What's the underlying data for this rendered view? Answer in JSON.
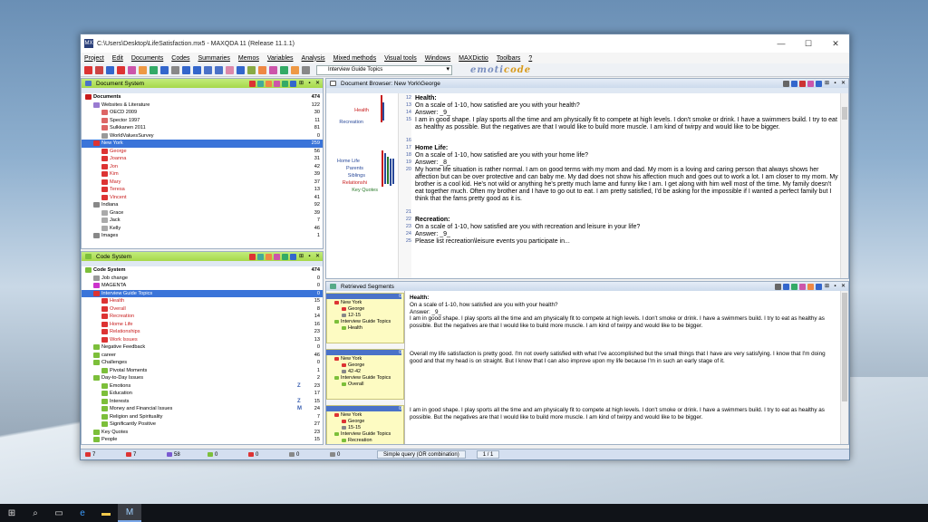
{
  "window": {
    "title": "C:\\Users\\Desktop\\LifeSatisfaction.mx5 - MAXQDA 11  (Release 11.1.1)",
    "app_icon": "MX"
  },
  "menu": [
    "Project",
    "Edit",
    "Documents",
    "Codes",
    "Summaries",
    "Memos",
    "Variables",
    "Analysis",
    "Mixed methods",
    "Visual tools",
    "Windows",
    "MAXDictio",
    "Toolbars",
    "?"
  ],
  "toolbar": {
    "combo_value": "Interview Guide Topics",
    "logo": "emoticode",
    "logo_left": "emoti",
    "logo_right": "code"
  },
  "doc_system": {
    "title": "Document System",
    "rows": [
      {
        "label": "Documents",
        "num": "474",
        "level": 0,
        "style": "bold",
        "color": "#c81c1c"
      },
      {
        "label": "Websites & Literature",
        "num": "122",
        "level": 1,
        "color": "#9a7bd1"
      },
      {
        "label": "OECD 2009",
        "num": "30",
        "level": 2,
        "color": "#d66"
      },
      {
        "label": "Spector 1997",
        "num": "11",
        "level": 2,
        "color": "#d66"
      },
      {
        "label": "Sulkkanen 2011",
        "num": "81",
        "level": 2,
        "color": "#d66"
      },
      {
        "label": "WorldValuesSurvey",
        "num": "0",
        "level": 2,
        "color": "#999"
      },
      {
        "label": "New York",
        "num": "259",
        "level": 1,
        "style": "sel",
        "color": "#d33"
      },
      {
        "label": "George",
        "num": "56",
        "level": 2,
        "style": "red",
        "color": "#d33"
      },
      {
        "label": "Joanna",
        "num": "31",
        "level": 2,
        "style": "red",
        "color": "#d33"
      },
      {
        "label": "Jon",
        "num": "42",
        "level": 2,
        "style": "red",
        "color": "#d33"
      },
      {
        "label": "Kim",
        "num": "39",
        "level": 2,
        "style": "red",
        "color": "#d33"
      },
      {
        "label": "Mary",
        "num": "37",
        "level": 2,
        "style": "red",
        "color": "#d33"
      },
      {
        "label": "Teresa",
        "num": "13",
        "level": 2,
        "style": "red",
        "color": "#d33"
      },
      {
        "label": "Vincent",
        "num": "41",
        "level": 2,
        "style": "red",
        "color": "#d33"
      },
      {
        "label": "Indiana",
        "num": "92",
        "level": 1,
        "color": "#888"
      },
      {
        "label": "Grace",
        "num": "39",
        "level": 2,
        "color": "#aaa"
      },
      {
        "label": "Jack",
        "num": "7",
        "level": 2,
        "color": "#aaa"
      },
      {
        "label": "Kelly",
        "num": "46",
        "level": 2,
        "color": "#aaa"
      },
      {
        "label": "Images",
        "num": "1",
        "level": 1,
        "color": "#888"
      }
    ]
  },
  "code_system": {
    "title": "Code System",
    "rows": [
      {
        "label": "Code System",
        "num": "474",
        "level": 0,
        "style": "bold",
        "color": "#7cbf3a",
        "ex": ""
      },
      {
        "label": "Job change",
        "num": "0",
        "level": 1,
        "color": "#999",
        "ex": ""
      },
      {
        "label": "MAGENTA",
        "num": "0",
        "level": 1,
        "color": "#c3c",
        "ex": ""
      },
      {
        "label": "Interview Guide Topics",
        "num": "0",
        "level": 1,
        "style": "sel",
        "color": "#d33",
        "ex": ""
      },
      {
        "label": "Health",
        "num": "15",
        "level": 2,
        "style": "red",
        "color": "#d33",
        "ex": ""
      },
      {
        "label": "Overall",
        "num": "8",
        "level": 2,
        "style": "red",
        "color": "#d33",
        "ex": ""
      },
      {
        "label": "Recreation",
        "num": "14",
        "level": 2,
        "style": "red",
        "color": "#d33",
        "ex": ""
      },
      {
        "label": "Home Life",
        "num": "16",
        "level": 2,
        "style": "red",
        "color": "#d33",
        "ex": ""
      },
      {
        "label": "Relationships",
        "num": "23",
        "level": 2,
        "style": "red",
        "color": "#d33",
        "ex": ""
      },
      {
        "label": "Work Issues",
        "num": "13",
        "level": 2,
        "style": "red",
        "color": "#d33",
        "ex": ""
      },
      {
        "label": "Negative Feedback",
        "num": "0",
        "level": 1,
        "color": "#7cbf3a",
        "ex": ""
      },
      {
        "label": "career",
        "num": "46",
        "level": 1,
        "color": "#7cbf3a",
        "ex": ""
      },
      {
        "label": "Challenges",
        "num": "0",
        "level": 1,
        "color": "#7cbf3a",
        "ex": ""
      },
      {
        "label": "Pivotal Moments",
        "num": "1",
        "level": 2,
        "color": "#7cbf3a",
        "ex": ""
      },
      {
        "label": "Day-to-Day Issues",
        "num": "2",
        "level": 1,
        "color": "#7cbf3a",
        "ex": ""
      },
      {
        "label": "Emotions",
        "num": "23",
        "level": 2,
        "color": "#7cbf3a",
        "ex": "Z"
      },
      {
        "label": "Education",
        "num": "17",
        "level": 2,
        "color": "#7cbf3a",
        "ex": ""
      },
      {
        "label": "Interests",
        "num": "15",
        "level": 2,
        "color": "#7cbf3a",
        "ex": "Z"
      },
      {
        "label": "Money and Financial Issues",
        "num": "24",
        "level": 2,
        "color": "#7cbf3a",
        "ex": "M"
      },
      {
        "label": "Religion and Spirituality",
        "num": "7",
        "level": 2,
        "color": "#7cbf3a",
        "ex": ""
      },
      {
        "label": "Significantly Positive",
        "num": "27",
        "level": 2,
        "color": "#7cbf3a",
        "ex": ""
      },
      {
        "label": "Key Quotes",
        "num": "23",
        "level": 1,
        "color": "#7cbf3a",
        "ex": ""
      },
      {
        "label": "People",
        "num": "15",
        "level": 1,
        "color": "#7cbf3a",
        "ex": ""
      }
    ]
  },
  "browser": {
    "title": "Document Browser: New York\\George",
    "line_numbers": [
      "12",
      "13",
      "14",
      "15",
      "",
      "16",
      "17",
      "18",
      "19",
      "20",
      "",
      "",
      "",
      "",
      "",
      "",
      "",
      "21",
      "22",
      "23",
      "24"
    ],
    "paragraphs": [
      {
        "lines": [
          "12"
        ],
        "text": "Health:",
        "bold": true
      },
      {
        "lines": [
          "13"
        ],
        "text": "On a scale of 1-10, how satisfied are you with your health?"
      },
      {
        "lines": [
          "14"
        ],
        "text": "Answer: _9_"
      },
      {
        "lines": [
          "15"
        ],
        "text": "I am in good shape. I play sports all the time and am physically fit to compete at high levels. I don't smoke or drink. I have a swimmers build. I try to eat as healthy as possible. But the negatives are that I would like to build more muscle. I am kind of twirpy and would like to be bigger."
      },
      {
        "lines": [
          "16"
        ],
        "text": ""
      },
      {
        "lines": [
          "17"
        ],
        "text": "Home Life:",
        "bold": true
      },
      {
        "lines": [
          "18"
        ],
        "text": "On a scale of 1-10, how satisfied are you with your home life?"
      },
      {
        "lines": [
          "19"
        ],
        "text": "Answer: _8_"
      },
      {
        "lines": [
          "20"
        ],
        "text": "My home life situation is rather normal. I am on good terms with my mom and dad. My mom is a loving and caring person that always shows her affection but can be over protective and can baby me. My dad does not show his affection much and goes out to work a lot. I am closer to my mom. My brother is a cool kid. He's not wild or anything he's pretty much lame and funny like I am. I get along with him well most of the time. My family doesn't eat together much. Often my brother and I have to go out to eat.  I am pretty satisfied, I'd be asking for the impossible if I wanted a perfect family but I think that the fams pretty good as it is."
      },
      {
        "lines": [
          "21"
        ],
        "text": ""
      },
      {
        "lines": [
          "22"
        ],
        "text": "Recreation:",
        "bold": true
      },
      {
        "lines": [
          "23"
        ],
        "text": "On a scale of 1-10, how satisfied are you with recreation and leisure in your life?"
      },
      {
        "lines": [
          "24"
        ],
        "text": "Answer: _9_"
      },
      {
        "lines": [
          "25"
        ],
        "text": "Please list recreation\\leisure events you participate in..."
      }
    ],
    "margin_codes": [
      {
        "label": "Health",
        "color": "#c81c1c"
      },
      {
        "label": "Recreation",
        "color": "#2a4a9a"
      },
      {
        "label": "Home Life",
        "color": "#2a4a9a"
      },
      {
        "label": "Parents",
        "color": "#2a4a9a"
      },
      {
        "label": "Siblings",
        "color": "#2a4a9a"
      },
      {
        "label": "Relationshi",
        "color": "#c81c1c"
      },
      {
        "label": "Key Quotes",
        "color": "#2a7a2a"
      }
    ]
  },
  "retrieved": {
    "title": "Retrieved Segments",
    "segments": [
      {
        "num": "0",
        "doc": "New York",
        "person": "George",
        "range": "12-15",
        "topic": "Interview Guide Topics",
        "code": "Health",
        "heading": "Health:",
        "lines": [
          "On a scale of 1-10, how satisfied are you with your health?",
          "Answer: _9_",
          "I am in good shape. I play sports all the time and am physically fit to compete at high levels. I don't smoke or drink. I have a swimmers build. I try to eat as healthy as possible. But the negatives are that I would like to build more muscle. I am kind of twirpy and would like to be bigger."
        ]
      },
      {
        "num": "0",
        "doc": "New York",
        "person": "George",
        "range": "42-42",
        "topic": "Interview Guide Topics",
        "code": "Overall",
        "heading": "",
        "lines": [
          "Overall my life satisfaction is pretty good. I'm not overly satisfied with what I've accomplished but the small things that I have are very satisfying. I know that I'm doing good and that my head is on straight.  But I know that I can also improve upon my life because I'm in such an early stage of it."
        ]
      },
      {
        "num": "0",
        "doc": "New York",
        "person": "George",
        "range": "15-15",
        "topic": "Interview Guide Topics",
        "code": "Recreation",
        "heading": "",
        "lines": [
          "I am in good shape. I play sports all the time and am physically fit to compete at high levels. I don't smoke or drink. I have a swimmers build. I try to eat as healthy as possible. But the negatives are that I would like to build more muscle. I am kind of twirpy and would like to be bigger."
        ]
      },
      {
        "num": "0",
        "doc": "New York",
        "person": "George",
        "range": "",
        "topic": "",
        "code": "",
        "heading": "Recreation:",
        "lines": [
          "On a scale of 1-10, how satisfied are you with recreation and leisure in your life?"
        ]
      }
    ]
  },
  "status": {
    "items": [
      {
        "value": "7",
        "color": "#d33"
      },
      {
        "value": "7",
        "color": "#d33"
      },
      {
        "value": "58",
        "color": "#7a5ad1"
      },
      {
        "value": "0",
        "color": "#7cbf3a"
      },
      {
        "value": "0",
        "color": "#d33"
      },
      {
        "value": "0",
        "color": "#888"
      },
      {
        "value": "0",
        "color": "#888"
      }
    ],
    "query": "Simple query (OR combination)",
    "pages": "1 / 1"
  },
  "taskbar": [
    "start-icon",
    "search-icon",
    "task-view-icon",
    "edge-icon",
    "explorer-icon",
    "maxqda-icon"
  ]
}
